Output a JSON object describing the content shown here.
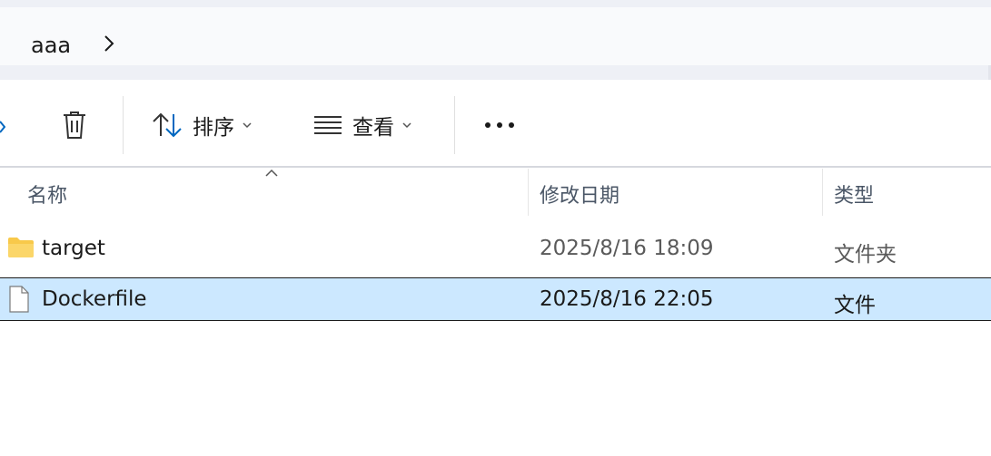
{
  "breadcrumb": {
    "items": [
      "aaa"
    ]
  },
  "toolbar": {
    "delete_icon": "trash-icon",
    "sort_label": "排序",
    "view_label": "查看",
    "more_icon": "ellipsis-icon"
  },
  "columns": {
    "name": "名称",
    "date": "修改日期",
    "type": "类型",
    "sorted_by": "name"
  },
  "files": [
    {
      "name": "target",
      "date": "2025/8/16 18:09",
      "type": "文件夹",
      "icon": "folder-icon",
      "selected": false
    },
    {
      "name": "Dockerfile",
      "date": "2025/8/16 22:05",
      "type": "文件",
      "icon": "file-icon",
      "selected": true
    }
  ],
  "colors": {
    "selection": "#cce8ff",
    "folder": "#f8c94a",
    "accent": "#0067c0"
  }
}
